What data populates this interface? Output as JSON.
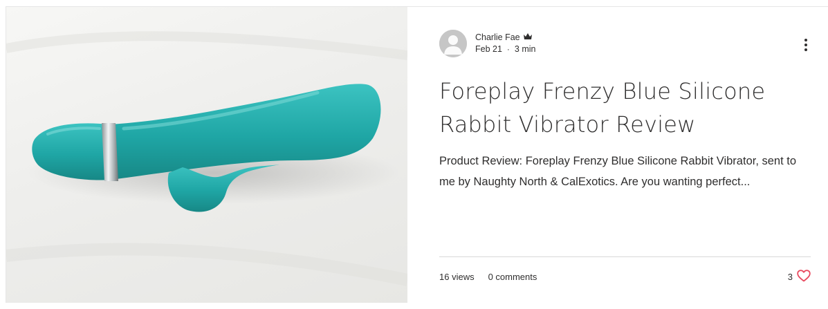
{
  "post": {
    "author": {
      "name": "Charlie Fae",
      "badge_icon": "crown-icon"
    },
    "date": "Feb 21",
    "separator": "·",
    "read_time": "3 min",
    "title": "Foreplay Frenzy Blue Silicone Rabbit Vibrator Review",
    "excerpt": "Product Review: Foreplay Frenzy Blue Silicone Rabbit Vibrator, sent to me by Naughty North & CalExotics. Are you wanting perfect...",
    "stats": {
      "views": "16 views",
      "comments": "0 comments",
      "likes": "3"
    },
    "colors": {
      "heart": "#e84a5f",
      "text": "#2f2e2e",
      "product": "#1fa6a5"
    }
  }
}
